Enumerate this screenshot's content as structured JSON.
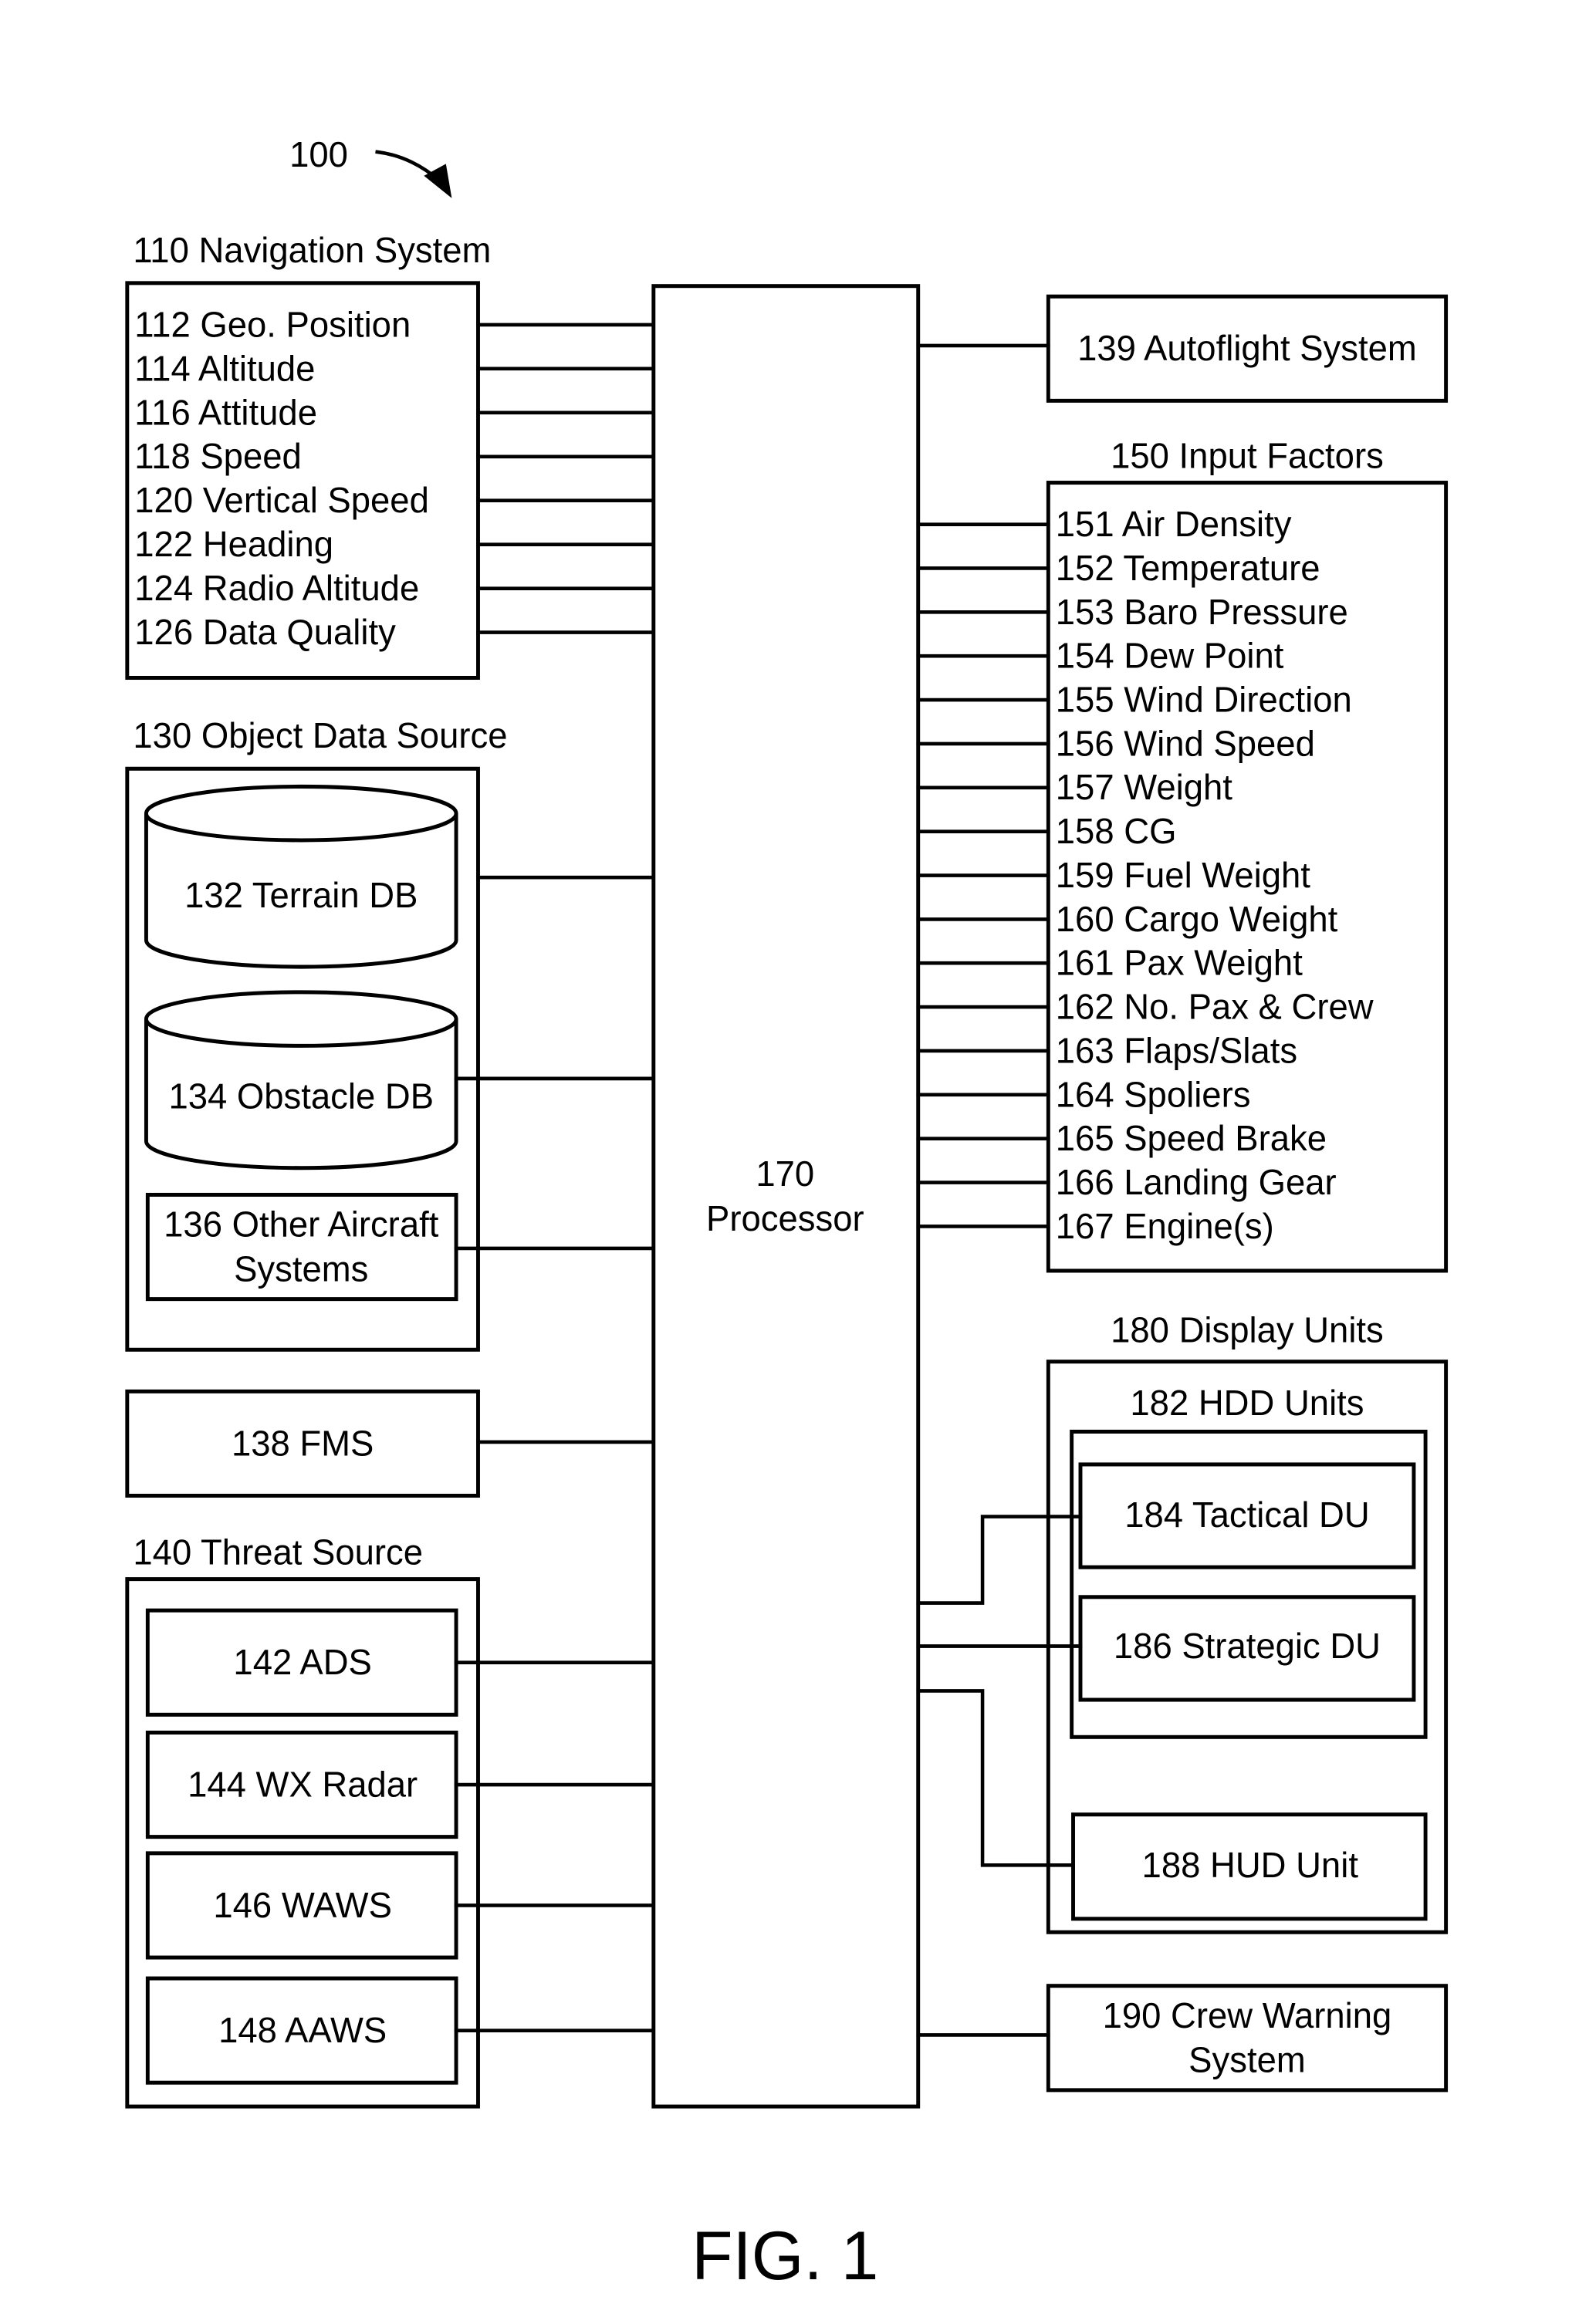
{
  "figure": {
    "reference_number": "100",
    "caption": "FIG. 1",
    "colors": {
      "stroke": "#000000",
      "background": "#ffffff"
    }
  },
  "navigation_system": {
    "title": "110 Navigation System",
    "items": [
      "112 Geo. Position",
      "114 Altitude",
      "116 Attitude",
      "118 Speed",
      "120 Vertical Speed",
      "122 Heading",
      "124 Radio Altitude",
      "126 Data Quality"
    ]
  },
  "object_data_source": {
    "title": "130 Object Data Source",
    "terrain_db": "132 Terrain DB",
    "obstacle_db": "134 Obstacle DB",
    "other_aircraft_systems": [
      "136 Other Aircraft",
      "Systems"
    ]
  },
  "fms": {
    "label": "138 FMS"
  },
  "threat_source": {
    "title": "140 Threat Source",
    "items": [
      "142 ADS",
      "144 WX Radar",
      "146 WAWS",
      "148 AAWS"
    ]
  },
  "processor": {
    "number": "170",
    "label": "Processor"
  },
  "autoflight": {
    "label": "139 Autoflight System"
  },
  "input_factors": {
    "title": "150 Input Factors",
    "items": [
      "151 Air Density",
      "152 Temperature",
      "153 Baro Pressure",
      "154 Dew Point",
      "155 Wind Direction",
      "156 Wind Speed",
      "157 Weight",
      "158 CG",
      "159 Fuel Weight",
      "160 Cargo Weight",
      "161 Pax Weight",
      "162 No. Pax & Crew",
      "163 Flaps/Slats",
      "164 Spoliers",
      "165 Speed Brake",
      "166 Landing Gear",
      "167 Engine(s)"
    ]
  },
  "display_units": {
    "title": "180 Display Units",
    "hdd_units": {
      "title": "182 HDD Units",
      "tactical": "184 Tactical DU",
      "strategic": "186 Strategic DU"
    },
    "hud_unit": "188 HUD Unit"
  },
  "crew_warning": {
    "lines": [
      "190 Crew Warning",
      "System"
    ]
  }
}
